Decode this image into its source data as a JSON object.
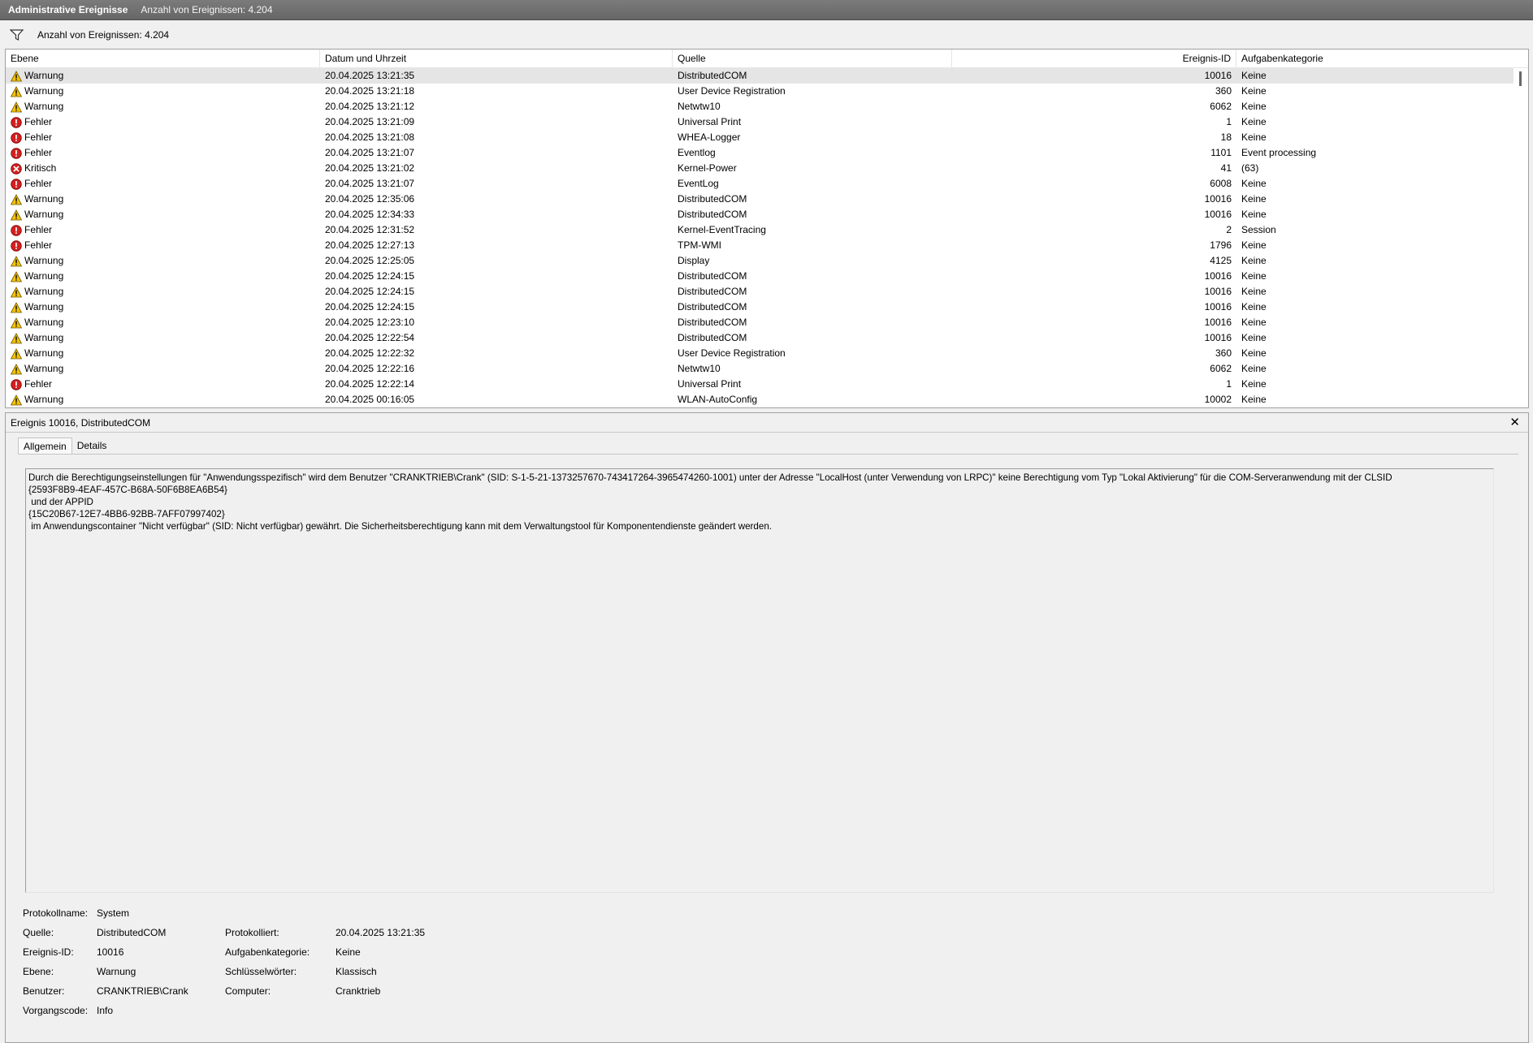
{
  "titlebar": {
    "title": "Administrative Ereignisse",
    "count": "Anzahl von Ereignissen: 4.204"
  },
  "filterbar": {
    "text": "Anzahl von Ereignissen: 4.204"
  },
  "columns": {
    "level": "Ebene",
    "datetime": "Datum und Uhrzeit",
    "source": "Quelle",
    "eventid": "Ereignis-ID",
    "category": "Aufgabenkategorie"
  },
  "rows": [
    {
      "icon": "warning",
      "level": "Warnung",
      "datetime": "20.04.2025 13:21:35",
      "source": "DistributedCOM",
      "eventid": "10016",
      "category": "Keine"
    },
    {
      "icon": "warning",
      "level": "Warnung",
      "datetime": "20.04.2025 13:21:18",
      "source": "User Device Registration",
      "eventid": "360",
      "category": "Keine"
    },
    {
      "icon": "warning",
      "level": "Warnung",
      "datetime": "20.04.2025 13:21:12",
      "source": "Netwtw10",
      "eventid": "6062",
      "category": "Keine"
    },
    {
      "icon": "error",
      "level": "Fehler",
      "datetime": "20.04.2025 13:21:09",
      "source": "Universal Print",
      "eventid": "1",
      "category": "Keine"
    },
    {
      "icon": "error",
      "level": "Fehler",
      "datetime": "20.04.2025 13:21:08",
      "source": "WHEA-Logger",
      "eventid": "18",
      "category": "Keine"
    },
    {
      "icon": "error",
      "level": "Fehler",
      "datetime": "20.04.2025 13:21:07",
      "source": "Eventlog",
      "eventid": "1101",
      "category": "Event processing"
    },
    {
      "icon": "critical",
      "level": "Kritisch",
      "datetime": "20.04.2025 13:21:02",
      "source": "Kernel-Power",
      "eventid": "41",
      "category": "(63)"
    },
    {
      "icon": "error",
      "level": "Fehler",
      "datetime": "20.04.2025 13:21:07",
      "source": "EventLog",
      "eventid": "6008",
      "category": "Keine"
    },
    {
      "icon": "warning",
      "level": "Warnung",
      "datetime": "20.04.2025 12:35:06",
      "source": "DistributedCOM",
      "eventid": "10016",
      "category": "Keine"
    },
    {
      "icon": "warning",
      "level": "Warnung",
      "datetime": "20.04.2025 12:34:33",
      "source": "DistributedCOM",
      "eventid": "10016",
      "category": "Keine"
    },
    {
      "icon": "error",
      "level": "Fehler",
      "datetime": "20.04.2025 12:31:52",
      "source": "Kernel-EventTracing",
      "eventid": "2",
      "category": "Session"
    },
    {
      "icon": "error",
      "level": "Fehler",
      "datetime": "20.04.2025 12:27:13",
      "source": "TPM-WMI",
      "eventid": "1796",
      "category": "Keine"
    },
    {
      "icon": "warning",
      "level": "Warnung",
      "datetime": "20.04.2025 12:25:05",
      "source": "Display",
      "eventid": "4125",
      "category": "Keine"
    },
    {
      "icon": "warning",
      "level": "Warnung",
      "datetime": "20.04.2025 12:24:15",
      "source": "DistributedCOM",
      "eventid": "10016",
      "category": "Keine"
    },
    {
      "icon": "warning",
      "level": "Warnung",
      "datetime": "20.04.2025 12:24:15",
      "source": "DistributedCOM",
      "eventid": "10016",
      "category": "Keine"
    },
    {
      "icon": "warning",
      "level": "Warnung",
      "datetime": "20.04.2025 12:24:15",
      "source": "DistributedCOM",
      "eventid": "10016",
      "category": "Keine"
    },
    {
      "icon": "warning",
      "level": "Warnung",
      "datetime": "20.04.2025 12:23:10",
      "source": "DistributedCOM",
      "eventid": "10016",
      "category": "Keine"
    },
    {
      "icon": "warning",
      "level": "Warnung",
      "datetime": "20.04.2025 12:22:54",
      "source": "DistributedCOM",
      "eventid": "10016",
      "category": "Keine"
    },
    {
      "icon": "warning",
      "level": "Warnung",
      "datetime": "20.04.2025 12:22:32",
      "source": "User Device Registration",
      "eventid": "360",
      "category": "Keine"
    },
    {
      "icon": "warning",
      "level": "Warnung",
      "datetime": "20.04.2025 12:22:16",
      "source": "Netwtw10",
      "eventid": "6062",
      "category": "Keine"
    },
    {
      "icon": "error",
      "level": "Fehler",
      "datetime": "20.04.2025 12:22:14",
      "source": "Universal Print",
      "eventid": "1",
      "category": "Keine"
    },
    {
      "icon": "warning",
      "level": "Warnung",
      "datetime": "20.04.2025 00:16:05",
      "source": "WLAN-AutoConfig",
      "eventid": "10002",
      "category": "Keine"
    }
  ],
  "detail": {
    "title": "Ereignis 10016, DistributedCOM",
    "close": "✕",
    "tabs": {
      "general": "Allgemein",
      "details": "Details"
    },
    "message": "Durch die Berechtigungseinstellungen für \"Anwendungsspezifisch\" wird dem Benutzer \"CRANKTRIEB\\Crank\" (SID: S-1-5-21-1373257670-743417264-3965474260-1001) unter der Adresse \"LocalHost (unter Verwendung von LRPC)\" keine Berechtigung vom Typ \"Lokal Aktivierung\" für die COM-Serveranwendung mit der CLSID\n{2593F8B9-4EAF-457C-B68A-50F6B8EA6B54}\n und der APPID\n{15C20B67-12E7-4BB6-92BB-7AFF07997402}\n im Anwendungscontainer \"Nicht verfügbar\" (SID: Nicht verfügbar) gewährt. Die Sicherheitsberechtigung kann mit dem Verwaltungstool für Komponentendienste geändert werden.",
    "props": {
      "logname_label": "Protokollname:",
      "logname": "System",
      "source_label": "Quelle:",
      "source": "DistributedCOM",
      "logged_label": "Protokolliert:",
      "logged": "20.04.2025 13:21:35",
      "eventid_label": "Ereignis-ID:",
      "eventid": "10016",
      "category_label": "Aufgabenkategorie:",
      "category": "Keine",
      "level_label": "Ebene:",
      "level": "Warnung",
      "keywords_label": "Schlüsselwörter:",
      "keywords": "Klassisch",
      "user_label": "Benutzer:",
      "user": "CRANKTRIEB\\Crank",
      "computer_label": "Computer:",
      "computer": "Cranktrieb",
      "opcode_label": "Vorgangscode:",
      "opcode": "Info"
    }
  },
  "colors": {
    "warning": "#f5c400",
    "error": "#d42020",
    "critical": "#d42020",
    "selected_row": "#e5e5e5"
  }
}
